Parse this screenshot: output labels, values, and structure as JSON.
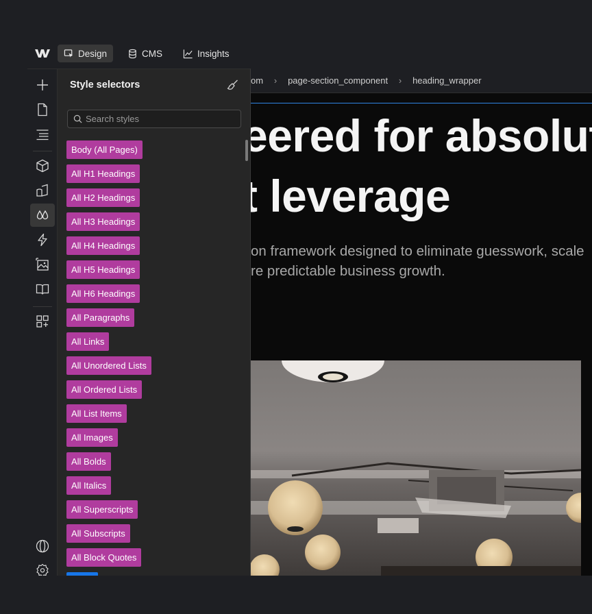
{
  "topbar": {
    "tabs": [
      {
        "label": "Design",
        "icon": "design-cursor-icon",
        "active": true
      },
      {
        "label": "CMS",
        "icon": "database-icon",
        "active": false
      },
      {
        "label": "Insights",
        "icon": "chart-icon",
        "active": false
      }
    ]
  },
  "rail": {
    "items": [
      {
        "icon": "plus-icon"
      },
      {
        "icon": "page-icon"
      },
      {
        "icon": "navigator-icon"
      },
      {
        "icon": "cube-icon"
      },
      {
        "icon": "style-guide-icon"
      },
      {
        "icon": "style-selectors-icon",
        "active": true
      },
      {
        "icon": "interactions-icon"
      },
      {
        "icon": "assets-icon"
      },
      {
        "icon": "book-icon"
      },
      {
        "icon": "apps-icon"
      },
      {
        "icon": "globe-icon"
      },
      {
        "icon": "settings-icon"
      }
    ]
  },
  "panel": {
    "title": "Style selectors",
    "search_placeholder": "Search styles",
    "tags": [
      "Body (All Pages)",
      "All H1 Headings",
      "All H2 Headings",
      "All H3 Headings",
      "All H4 Headings",
      "All H5 Headings",
      "All H6 Headings",
      "All Paragraphs",
      "All Links",
      "All Unordered Lists",
      "All Ordered Lists",
      "All List Items",
      "All Images",
      "All Bolds",
      "All Italics",
      "All Superscripts",
      "All Subscripts",
      "All Block Quotes"
    ],
    "tag_color": "#b03c9e"
  },
  "canvas": {
    "breadcrumb": [
      "om",
      "page-section_component",
      "heading_wrapper"
    ],
    "headline_line1": "eered for absolut",
    "headline_line2": "t leverage",
    "subtext_line1": "on framework designed to eliminate guesswork, scale",
    "subtext_line2": "re predictable business growth.",
    "selection_color": "#2f86e6"
  }
}
